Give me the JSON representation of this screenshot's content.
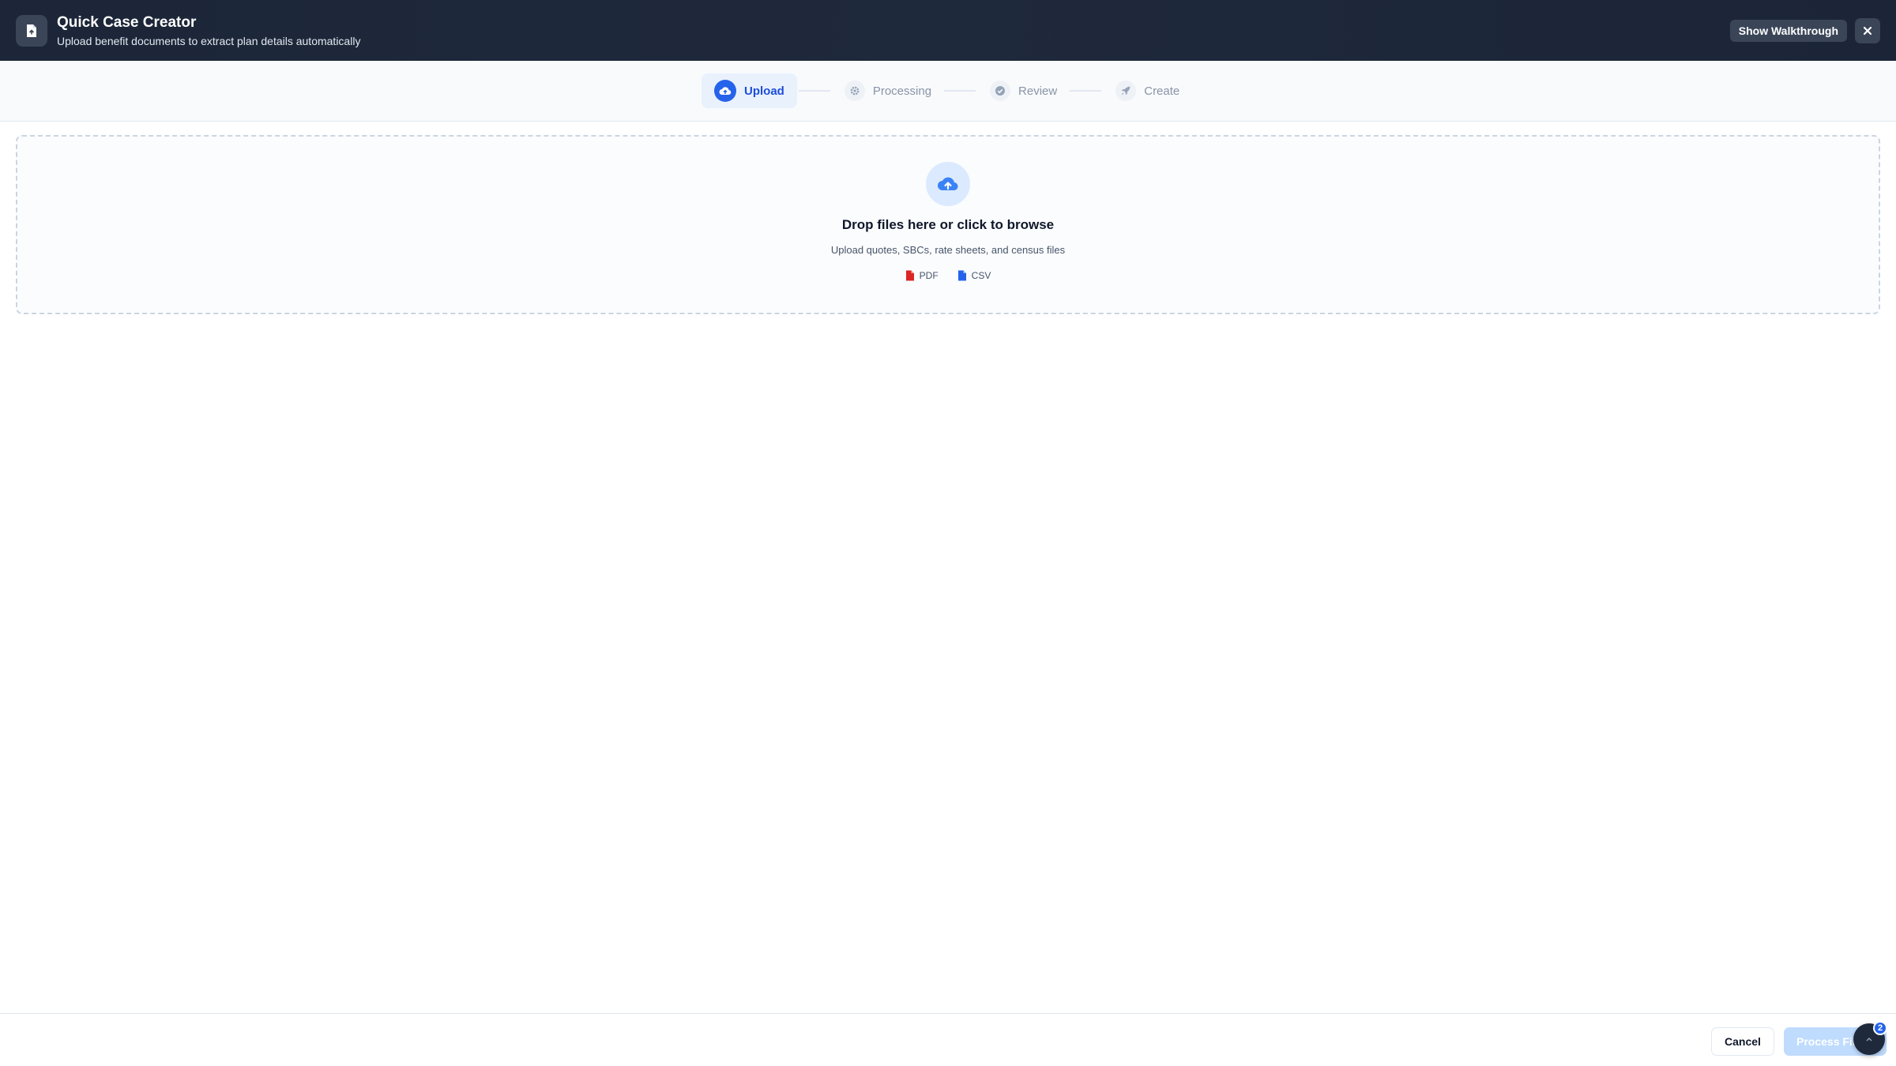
{
  "header": {
    "title": "Quick Case Creator",
    "subtitle": "Upload benefit documents to extract plan details automatically",
    "walkthrough_label": "Show Walkthrough",
    "close_symbol": "×",
    "icon": "document-icon"
  },
  "stepper": {
    "steps": [
      {
        "label": "Upload",
        "icon": "cloud-upload-icon",
        "state": "active"
      },
      {
        "label": "Processing",
        "icon": "gear-icon",
        "state": "pending"
      },
      {
        "label": "Review",
        "icon": "check-circle-icon",
        "state": "pending"
      },
      {
        "label": "Create",
        "icon": "rocket-icon",
        "state": "pending"
      }
    ]
  },
  "dropzone": {
    "title": "Drop files here or click to browse",
    "subtitle": "Upload quotes, SBCs, rate sheets, and census files",
    "icon": "cloud-upload-icon",
    "file_types": [
      {
        "label": "PDF",
        "color": "#dc2626"
      },
      {
        "label": "CSV",
        "color": "#2563eb"
      }
    ]
  },
  "footer": {
    "cancel_label": "Cancel",
    "process_label": "Process Files"
  },
  "assistant": {
    "badge_count": "2"
  },
  "colors": {
    "accent": "#2563eb",
    "header_bg": "#1e293b",
    "process_disabled": "#bfdbfe"
  }
}
